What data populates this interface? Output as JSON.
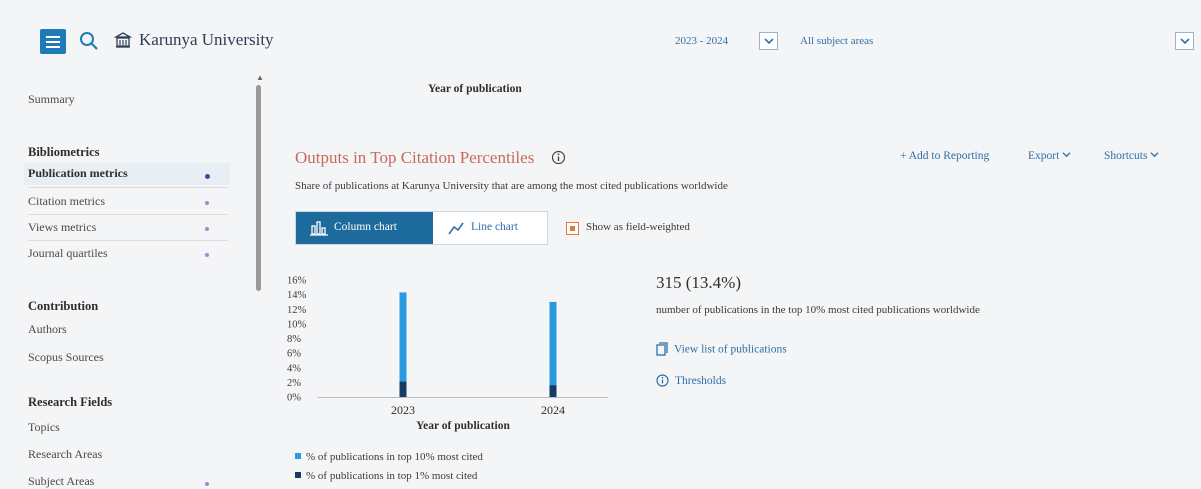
{
  "header": {
    "institution": "Karunya University",
    "year_range": "2023 - 2024",
    "subject_area": "All subject areas"
  },
  "sidebar": {
    "summary": "Summary",
    "bibliometrics_heading": "Bibliometrics",
    "items_biblio": [
      {
        "label": "Publication metrics",
        "active": true
      },
      {
        "label": "Citation metrics"
      },
      {
        "label": "Views metrics"
      },
      {
        "label": "Journal quartiles"
      }
    ],
    "contribution_heading": "Contribution",
    "items_contrib": [
      {
        "label": "Authors"
      },
      {
        "label": "Scopus Sources"
      }
    ],
    "research_heading": "Research Fields",
    "items_research": [
      {
        "label": "Topics"
      },
      {
        "label": "Research Areas"
      },
      {
        "label": "Subject Areas"
      }
    ]
  },
  "main": {
    "top_axis_label": "Year of publication",
    "section_title": "Outputs in Top Citation Percentiles",
    "subtitle": "Share of publications at Karunya University that are among the most cited publications worldwide",
    "add_to_reporting": "+ Add to Reporting",
    "export": "Export",
    "shortcuts": "Shortcuts",
    "tab_column": "Column chart",
    "tab_line": "Line chart",
    "field_weighted": "Show as field-weighted",
    "big_number": "315 (13.4%)",
    "big_desc": "number of publications in the top 10% most cited publications worldwide",
    "view_list": "View list of publications",
    "thresholds": "Thresholds"
  },
  "chart_data": {
    "type": "bar",
    "categories": [
      "2023",
      "2024"
    ],
    "series": [
      {
        "name": "% of publications in top 10% most cited",
        "values": [
          14.3,
          13.0
        ],
        "color": "#2a9ae0"
      },
      {
        "name": "% of publications in top 1% most cited",
        "values": [
          2.1,
          1.6
        ],
        "color": "#1a3a66"
      }
    ],
    "yticks": [
      "16%",
      "14%",
      "12%",
      "10%",
      "8%",
      "6%",
      "4%",
      "2%",
      "0%"
    ],
    "ylim": [
      0,
      16
    ],
    "xlabel": "Year of publication",
    "ylabel": "",
    "stacked": "overlay",
    "legend": "bottom-left"
  },
  "colors": {
    "accent": "#1d6a9c",
    "title": "#c86a5a",
    "link": "#2e6fa8",
    "checkbox": "#e07a3a"
  }
}
